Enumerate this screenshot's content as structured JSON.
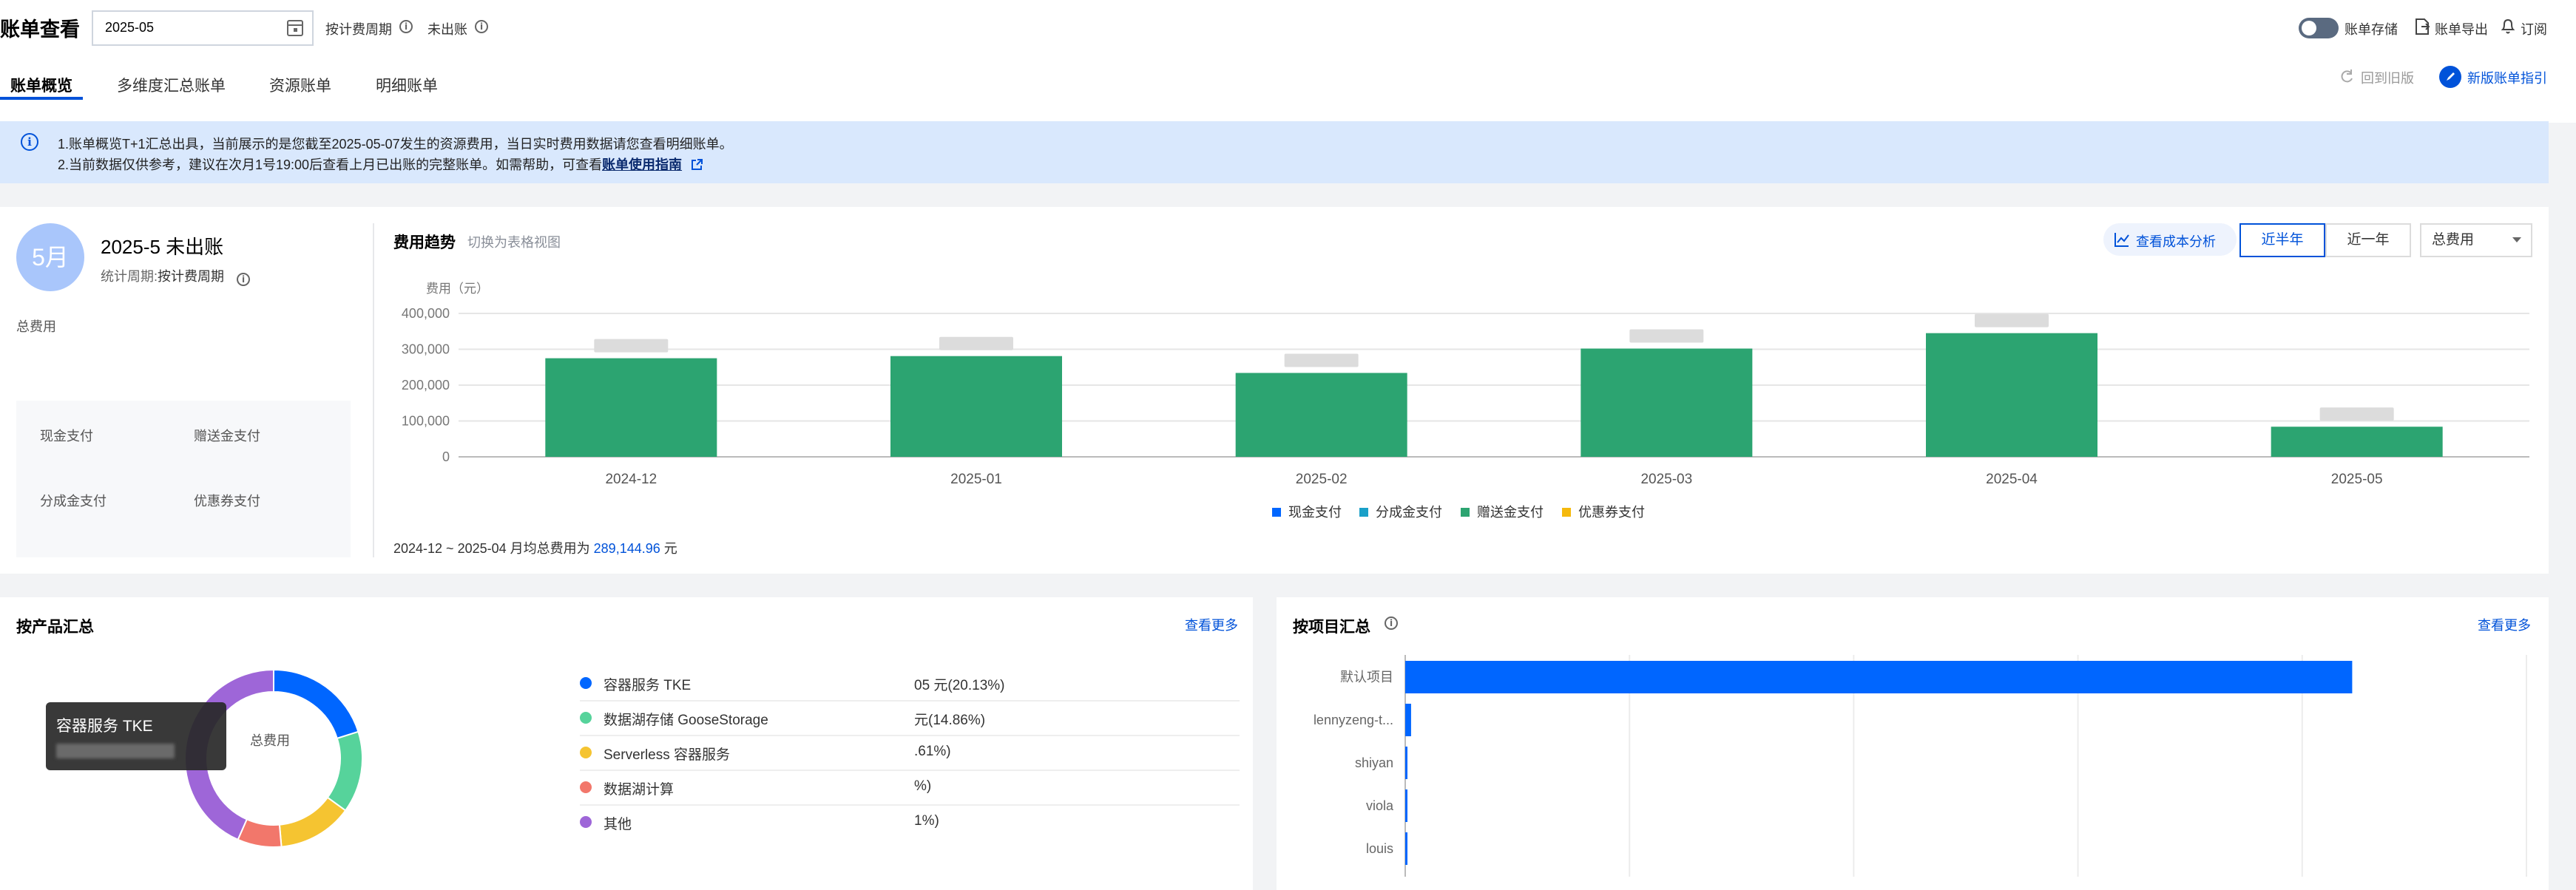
{
  "header": {
    "title": "账单查看",
    "month_value": "2025-05",
    "billing_cycle_label": "按计费周期",
    "unbilled_label": "未出账",
    "tabs": [
      {
        "label": "账单概览",
        "active": true
      },
      {
        "label": "多维度汇总账单",
        "active": false
      },
      {
        "label": "资源账单",
        "active": false
      },
      {
        "label": "明细账单",
        "active": false
      }
    ],
    "storage_label": "账单存储",
    "export_label": "账单导出",
    "subscribe_label": "订阅",
    "back_old_label": "回到旧版",
    "guide_label": "新版账单指引"
  },
  "notice": {
    "line1": "1.账单概览T+1汇总出具，当前展示的是您截至2025-05-07发生的资源费用，当日实时费用数据请您查看明细账单。",
    "line2_prefix": "2.当前数据仅供参考，建议在次月1号19:00后查看上月已出账的完整账单。如需帮助，可查看",
    "line2_link": "账单使用指南"
  },
  "summary": {
    "badge": "5月",
    "title": "2025-5 未出账",
    "period_label": "统计周期:",
    "period_value": "按计费周期",
    "total_label": "总费用",
    "total_value": "",
    "cash_label": "现金支付",
    "cash_value": "",
    "gift_label": "赠送金支付",
    "gift_value": "",
    "share_label": "分成金支付",
    "share_value": "",
    "coupon_label": "优惠券支付",
    "coupon_value": ""
  },
  "trend": {
    "title": "费用趋势",
    "switch_label": "切换为表格视图",
    "cost_analysis_label": "查看成本分析",
    "range_options": [
      "近半年",
      "近一年"
    ],
    "active_range": "近半年",
    "select_value": "总费用",
    "footer_prefix": "2024-12 ~ 2025-04 月均总费用为",
    "footer_value": "289,144.96",
    "footer_suffix": "元"
  },
  "chart_data": {
    "type": "bar",
    "ylabel": "费用（元）",
    "ylim": [
      0,
      400000
    ],
    "yticks": [
      "400,000",
      "300,000",
      "200,000",
      "100,000",
      "0"
    ],
    "categories": [
      "2024-12",
      "2025-01",
      "2025-02",
      "2025-03",
      "2025-04",
      "2025-05"
    ],
    "series": [
      {
        "name": "现金支付",
        "color": "#0066ff",
        "values": [
          0,
          0,
          0,
          0,
          0,
          0
        ]
      },
      {
        "name": "分成金支付",
        "color": "#1aa0c8",
        "values": [
          0,
          0,
          0,
          0,
          0,
          0
        ]
      },
      {
        "name": "赠送金支付",
        "color": "#2ca471",
        "values": [
          275000,
          281000,
          234000,
          302000,
          345000,
          84000
        ]
      },
      {
        "name": "优惠券支付",
        "color": "#f5b90d",
        "values": [
          0,
          0,
          0,
          0,
          0,
          0
        ]
      }
    ],
    "grid": true,
    "legend": "bottom"
  },
  "products": {
    "title": "按产品汇总",
    "more_label": "查看更多",
    "donut_center_label": "总费用",
    "tooltip_title": "容器服务 TKE",
    "items": [
      {
        "name": "容器服务 TKE",
        "color": "#0066ff",
        "amount": "05 元(20.13%)",
        "share": 20.13
      },
      {
        "name": "数据湖存储 GooseStorage",
        "color": "#56d39b",
        "amount": "元(14.86%)",
        "share": 14.86
      },
      {
        "name": "Serverless 容器服务",
        "color": "#f5c431",
        "amount": ".61%)",
        "share": 13.61
      },
      {
        "name": "数据湖计算",
        "color": "#f2776b",
        "amount": "%)",
        "share": 8.0
      },
      {
        "name": "其他",
        "color": "#9e66d8",
        "amount": "1%)",
        "share": 43.4
      }
    ]
  },
  "projects": {
    "title": "按项目汇总",
    "more_label": "查看更多",
    "items": [
      {
        "name": "默认项目",
        "value": 0.97
      },
      {
        "name": "lennyzeng-t...",
        "value": 0.006
      },
      {
        "name": "shiyan",
        "value": 0.002
      },
      {
        "name": "viola",
        "value": 0.002
      },
      {
        "name": "louis",
        "value": 0.002
      }
    ]
  }
}
